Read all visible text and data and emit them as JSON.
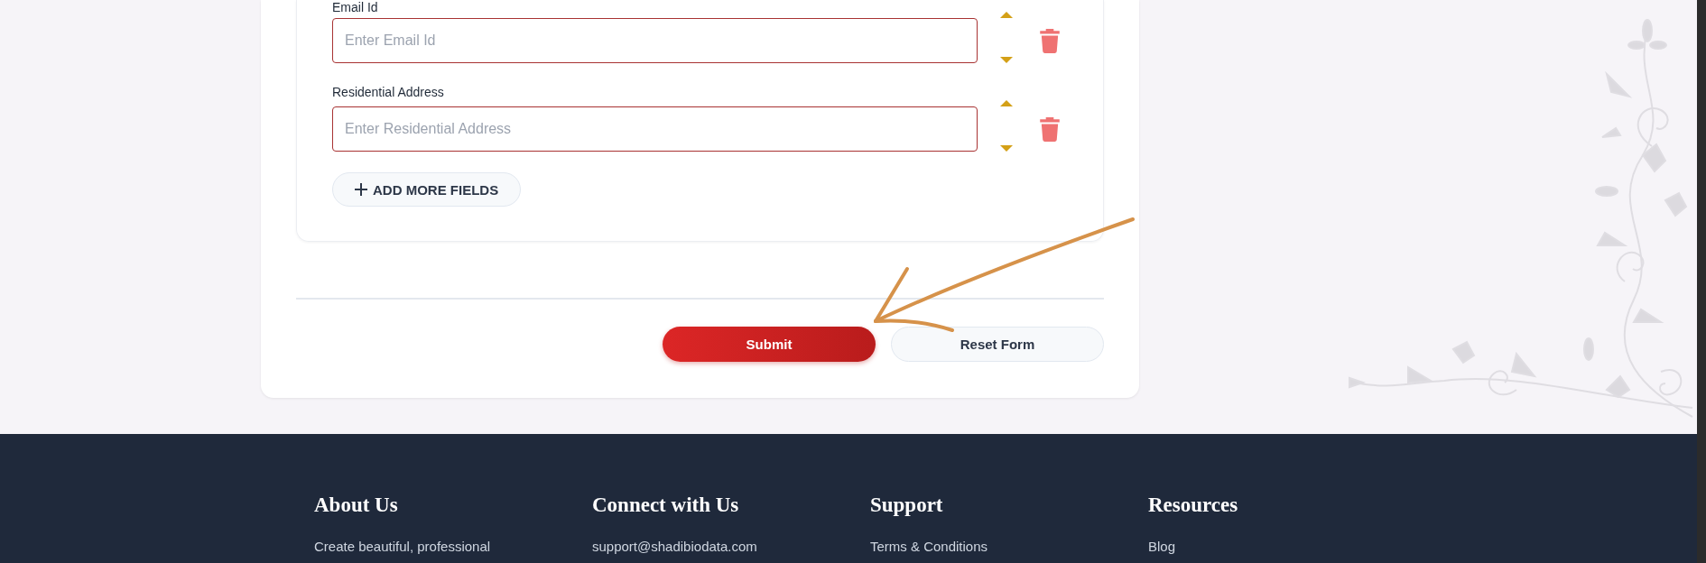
{
  "form": {
    "fields": [
      {
        "label": "Email Id",
        "placeholder": "Enter Email Id"
      },
      {
        "label": "Residential Address",
        "placeholder": "Enter Residential Address"
      }
    ],
    "add_button": "ADD MORE FIELDS",
    "actions": [
      {
        "kind": "primary",
        "label": "Submit"
      },
      {
        "kind": "secondary",
        "label": "Reset Form"
      }
    ]
  },
  "footer": {
    "columns": [
      {
        "heading": "About Us",
        "items": [
          "Create beautiful, professional"
        ]
      },
      {
        "heading": "Connect with Us",
        "items": [
          "support@shadibiodata.com"
        ]
      },
      {
        "heading": "Support",
        "items": [
          "Terms & Conditions"
        ]
      },
      {
        "heading": "Resources",
        "items": [
          "Blog"
        ]
      }
    ]
  }
}
